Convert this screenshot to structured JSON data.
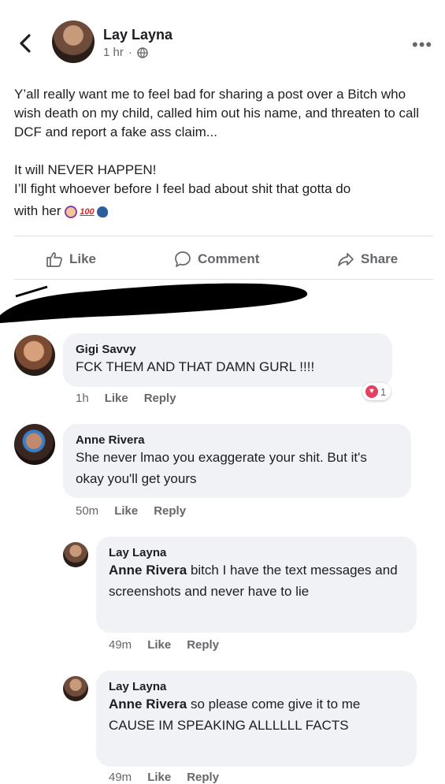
{
  "post": {
    "author": "Lay Layna",
    "time": "1 hr",
    "separator": "·",
    "paragraph1": "Y’all really want me to feel bad for sharing a post over a Bitch who wish death on my child, called him out his name, and threaten to call  DCF and report a fake ass claim...",
    "line2": "It will NEVER HAPPEN!",
    "line3": "I’ll fight whoever before I feel bad about shit that gotta do",
    "line4": "with her",
    "emoji_100": "100"
  },
  "actions": {
    "like": "Like",
    "comment": "Comment",
    "share": "Share"
  },
  "comments": [
    {
      "name": "Gigi Savvy",
      "text": "FCK THEM AND THAT DAMN GURL !!!!",
      "time": "1h",
      "like": "Like",
      "reply": "Reply",
      "reaction_count": "1"
    },
    {
      "name": "Anne Rivera",
      "text": "She never lmao you exaggerate your shit. But it's okay you'll get yours",
      "time": "50m",
      "like": "Like",
      "reply": "Reply"
    }
  ],
  "replies": [
    {
      "name": "Lay Layna",
      "tag": "Anne Rivera",
      "text": "bitch I have the text messages and screenshots and never have to lie",
      "time": "49m",
      "like": "Like",
      "reply": "Reply"
    },
    {
      "name": "Lay Layna",
      "tag": "Anne Rivera",
      "text": "so please come give it to me CAUSE IM SPEAKING ALLLLLL FACTS",
      "time": "49m",
      "like": "Like",
      "reply": "Reply"
    }
  ],
  "colors": {
    "secondary_text": "#65676b",
    "bubble": "#f0f2f5",
    "reaction_heart": "#e4405f"
  }
}
